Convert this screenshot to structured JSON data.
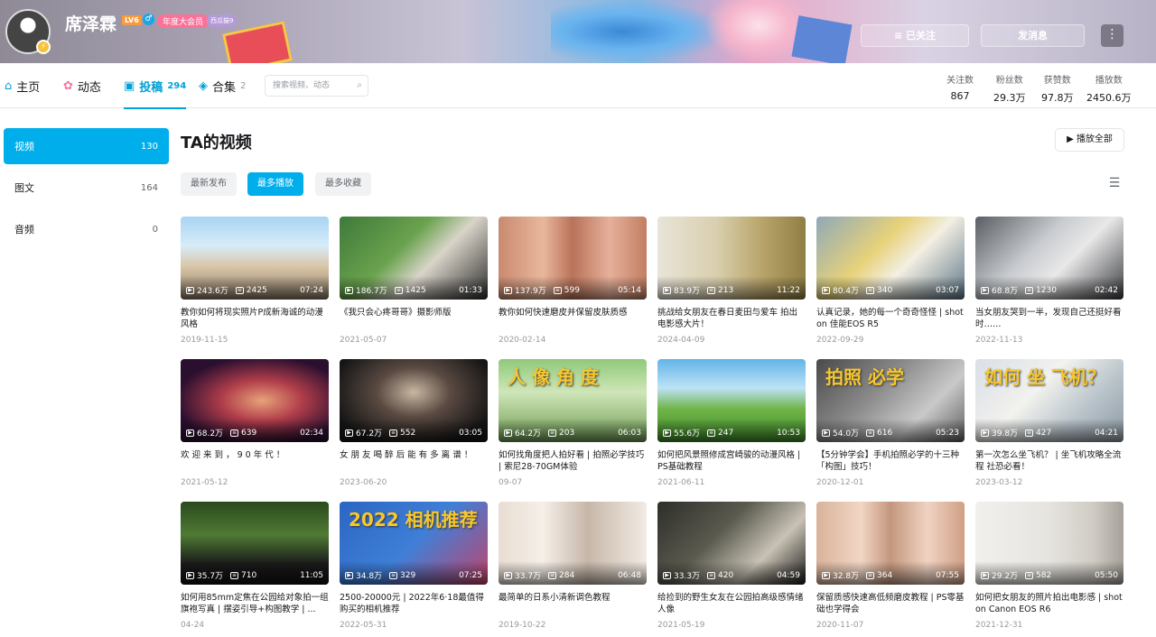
{
  "banner": {
    "username": "席泽霖",
    "level": "LV6",
    "vip": "年度大会员",
    "medal": "西瓜猫9",
    "follow_label": "≡ 已关注",
    "message_label": "发消息",
    "more_label": "⋮"
  },
  "nav": {
    "tabs": [
      {
        "label": "主页",
        "icon": "home-icon"
      },
      {
        "label": "动态",
        "icon": "dynamic-icon"
      },
      {
        "label": "投稿",
        "count": "294",
        "icon": "upload-icon"
      },
      {
        "label": "合集",
        "count": "2",
        "icon": "collection-icon"
      }
    ],
    "search_placeholder": "搜索视频、动态",
    "stats": [
      {
        "label": "关注数",
        "value": "867"
      },
      {
        "label": "粉丝数",
        "value": "29.3万"
      },
      {
        "label": "获赞数",
        "value": "97.8万"
      },
      {
        "label": "播放数",
        "value": "2450.6万"
      }
    ]
  },
  "sidebar": {
    "items": [
      {
        "label": "视频",
        "count": "130"
      },
      {
        "label": "图文",
        "count": "164"
      },
      {
        "label": "音频",
        "count": "0"
      }
    ]
  },
  "main": {
    "title": "TA的视频",
    "play_all": "▶ 播放全部",
    "sorts": [
      "最新发布",
      "最多播放",
      "最多收藏"
    ]
  },
  "videos": [
    {
      "plays": "243.6万",
      "comments": "2425",
      "duration": "07:24",
      "title": "教你如何将现实照片P成新海诚的动漫风格",
      "date": "2019-11-15",
      "bg": "linear-gradient(180deg,#a8d4f2 0%,#d7ecf9 35%,#d9c6a8 60%,#8a7a66 100%)"
    },
    {
      "plays": "186.7万",
      "comments": "1425",
      "duration": "01:33",
      "title": "《我只会心疼哥哥》摄影师版",
      "date": "2021-05-07",
      "bg": "linear-gradient(135deg,#3e7a3a 0%,#6aa24e 40%,#d9d4c9 60%,#2d2d2d 100%)"
    },
    {
      "plays": "137.9万",
      "comments": "599",
      "duration": "05:14",
      "title": "教你如何快速磨皮并保留皮肤质感",
      "date": "2020-02-14",
      "bg": "linear-gradient(90deg,#c98a6f 0%,#e9b79d 30%,#b9735a 50%,#e6b09a 75%,#c27e63 100%)"
    },
    {
      "plays": "83.9万",
      "comments": "213",
      "duration": "11:22",
      "title": "挑战给女朋友在春日麦田与爱车 拍出电影感大片！",
      "date": "2024-04-09",
      "bg": "linear-gradient(90deg,#e8e4d8 0%,#d9cfae 40%,#b9a56b 70%,#8f7e45 100%)"
    },
    {
      "plays": "80.4万",
      "comments": "340",
      "duration": "03:07",
      "title": "认真记录，她的每一个奇奇怪怪 | shot on 佳能EOS R5",
      "date": "2022-09-29",
      "bg": "linear-gradient(135deg,#8fa9b8 0%,#e7d27a 40%,#f3efe3 60%,#5d7688 100%)"
    },
    {
      "plays": "68.8万",
      "comments": "1230",
      "duration": "02:42",
      "title": "当女朋友哭到一半，发现自己还挺好看时……",
      "date": "2022-11-13",
      "bg": "linear-gradient(135deg,#5a5d63 0%,#c9ccd0 40%,#e8e8e8 60%,#3b3c40 100%)"
    },
    {
      "plays": "68.2万",
      "comments": "639",
      "duration": "02:34",
      "title": "欢 迎 来 到 ， 9 0 年 代 ！",
      "date": "2021-05-12",
      "bg": "radial-gradient(ellipse at 55% 50%,#e8a27a 0%,#b03d4a 35%,#2a0f2f 75%)"
    },
    {
      "plays": "67.2万",
      "comments": "552",
      "duration": "03:05",
      "title": "女 朋 友 喝 醉 后 能 有 多 离 谱 ！",
      "date": "2023-06-20",
      "bg": "radial-gradient(ellipse at 50% 40%,#c8b7a2 0%,#5a4a42 35%,#141414 80%)"
    },
    {
      "plays": "64.2万",
      "comments": "203",
      "duration": "06:03",
      "title": "如何找角度把人拍好看 | 拍照必学技巧 | 索尼28-70GM体验",
      "date": "09-07",
      "bg": "linear-gradient(180deg,#8fc97a 0%,#cfe6b8 40%,#6c9a52 100%)",
      "overlay": "人 像 角 度"
    },
    {
      "plays": "55.6万",
      "comments": "247",
      "duration": "10:53",
      "title": "如何把风景照修成宫崎骏的动漫风格 | PS基础教程",
      "date": "2021-06-11",
      "bg": "linear-gradient(180deg,#62b4e8 0%,#bde3f5 35%,#6fb548 60%,#3f8a2a 100%)"
    },
    {
      "plays": "54.0万",
      "comments": "616",
      "duration": "05:23",
      "title": "【5分钟学会】手机拍照必学的十三种「构图」技巧！",
      "date": "2020-12-01",
      "bg": "linear-gradient(135deg,#4a4a4a 0%,#8b8b8b 40%,#c9c9c9 70%,#5e5e5e 100%)",
      "overlay": "拍照 必学"
    },
    {
      "plays": "39.8万",
      "comments": "427",
      "duration": "04:21",
      "title": "第一次怎么坐飞机？ | 坐飞机攻略全流程 社恐必看！",
      "date": "2023-03-12",
      "bg": "linear-gradient(135deg,#d9dfe6 0%,#f2f2ee 40%,#b7c2c9 70%,#8d99a3 100%)",
      "overlay": "如何 坐 飞机？"
    },
    {
      "plays": "35.7万",
      "comments": "710",
      "duration": "11:05",
      "title": "如何用85mm定焦在公园给对象拍一组旗袍写真 | 摆姿引导+构图教学 | ...",
      "date": "04-24",
      "bg": "linear-gradient(180deg,#2a4a1e 0%,#4f7a33 40%,#1a1a1a 75%,#111 100%)"
    },
    {
      "plays": "34.8万",
      "comments": "329",
      "duration": "07:25",
      "title": "2500-20000元 | 2022年6·18最值得购买的相机推荐",
      "date": "2022-05-31",
      "bg": "linear-gradient(135deg,#2b66c2 0%,#3f7fd8 50%,#c1446a 100%)",
      "overlay": "2022 相机推荐"
    },
    {
      "plays": "33.7万",
      "comments": "284",
      "duration": "06:48",
      "title": "最简单的日系小清新调色教程",
      "date": "2019-10-22",
      "bg": "linear-gradient(90deg,#e8ddd2 0%,#f5efe8 30%,#c7b7a9 60%,#f2ebe4 100%)"
    },
    {
      "plays": "33.3万",
      "comments": "420",
      "duration": "04:59",
      "title": "给捡到的野生女友在公园拍高级感情绪人像",
      "date": "2021-05-19",
      "bg": "linear-gradient(135deg,#2e2e2a 0%,#5a5a4f 40%,#c9c2b5 70%,#1c1c1a 100%)"
    },
    {
      "plays": "32.8万",
      "comments": "364",
      "duration": "07:55",
      "title": "保留质感快速高低频磨皮教程 | PS零基础也学得会",
      "date": "2020-11-07",
      "bg": "linear-gradient(90deg,#d9b39b 0%,#f1d6c5 30%,#c4977d 50%,#f0d3c2 75%,#cf9f85 100%)"
    },
    {
      "plays": "29.2万",
      "comments": "582",
      "duration": "05:50",
      "title": "如何把女朋友的照片拍出电影感 | shot on Canon EOS R6",
      "date": "2021-12-31",
      "bg": "linear-gradient(90deg,#f1f0ed 0%,#e6e4df 50%,#cfcbc4 80%,#a5a099 100%)"
    }
  ]
}
